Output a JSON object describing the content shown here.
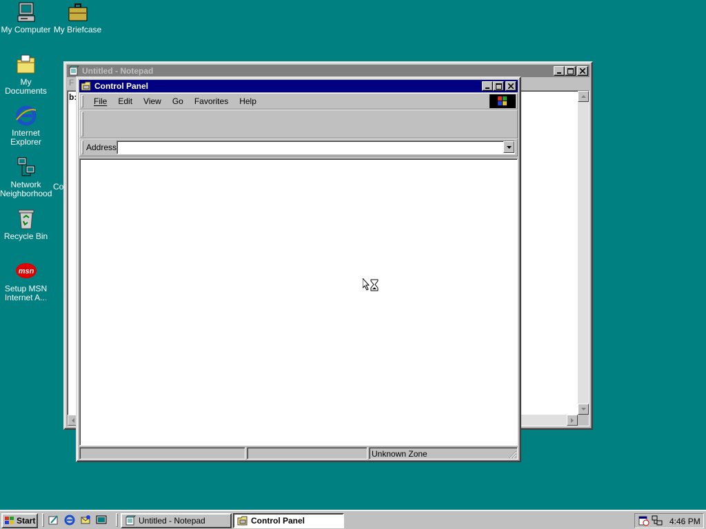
{
  "desktop": {
    "icons": [
      {
        "label": "My Computer"
      },
      {
        "label": "My Briefcase"
      },
      {
        "label": "My Documents"
      },
      {
        "label": "Internet Explorer"
      },
      {
        "label": "Network Neighborhood"
      },
      {
        "label": "Recycle Bin"
      },
      {
        "label": "Setup MSN Internet A..."
      }
    ],
    "partial_label": "Co"
  },
  "notepad": {
    "title": "Untitled - Notepad",
    "menu_partial": "F",
    "text_partial": "b:"
  },
  "control_panel": {
    "title": "Control Panel",
    "menu": [
      "File",
      "Edit",
      "View",
      "Go",
      "Favorites",
      "Help"
    ],
    "address_label": "Address",
    "address_value": "",
    "status_zone": "Unknown Zone"
  },
  "taskbar": {
    "start_label": "Start",
    "tasks": [
      {
        "label": "Untitled - Notepad",
        "active": false
      },
      {
        "label": "Control Panel",
        "active": true
      }
    ],
    "clock": "4:46 PM"
  },
  "colors": {
    "desktop": "#008080",
    "active_title": "#000080",
    "inactive_title": "#808080",
    "face": "#c0c0c0"
  }
}
